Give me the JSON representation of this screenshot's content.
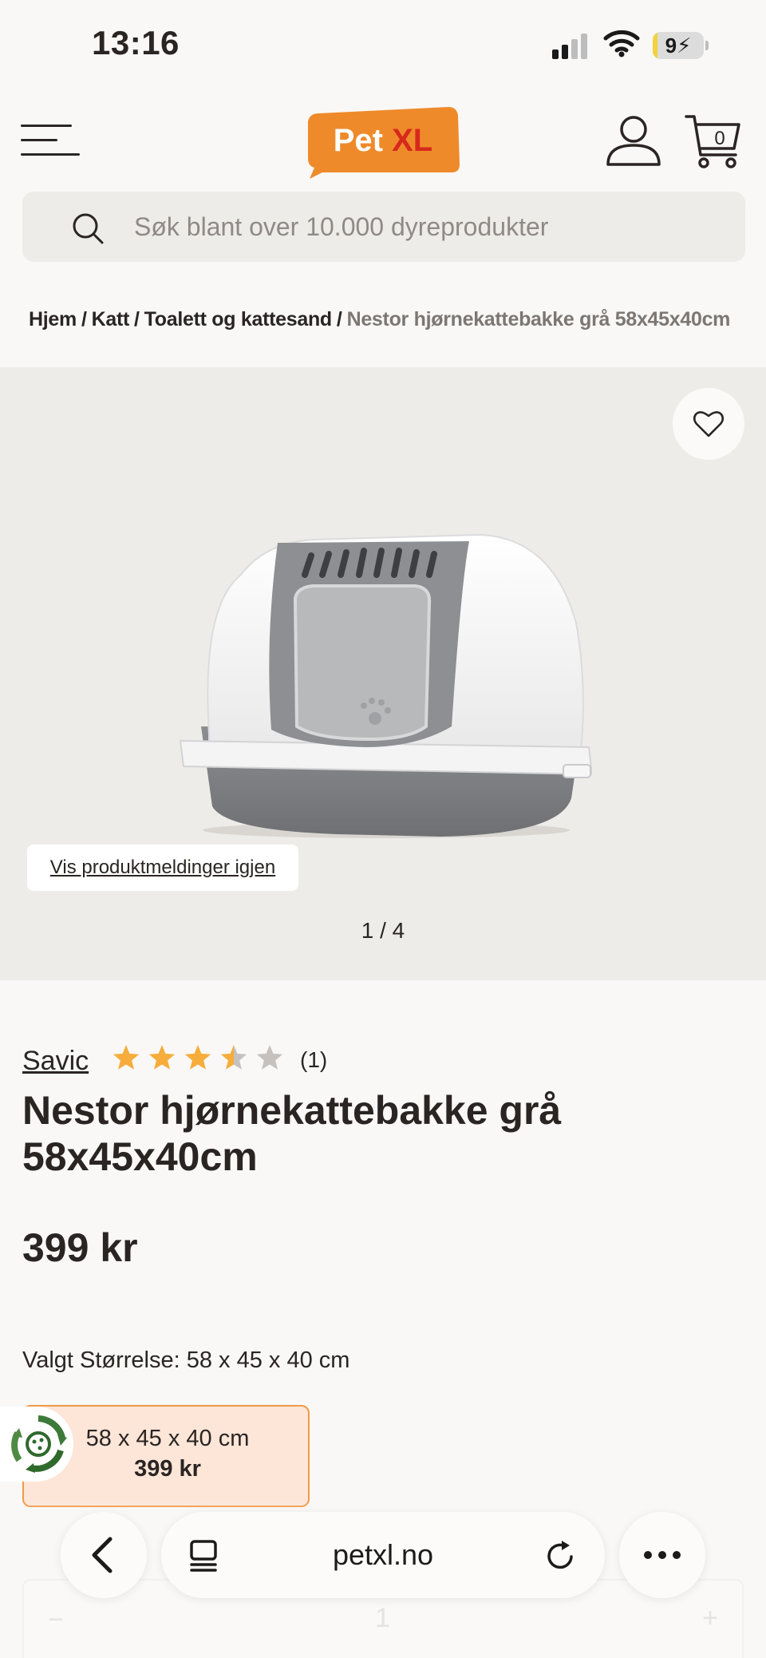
{
  "status_bar": {
    "time": "13:16",
    "battery_level": "9",
    "battery_percent": 9
  },
  "header": {
    "logo": {
      "pet": "Pet",
      "xl": "XL"
    },
    "cart_count": "0"
  },
  "search": {
    "placeholder": "Søk blant over 10.000 dyreprodukter"
  },
  "breadcrumb": {
    "items": [
      "Hjem",
      "Katt",
      "Toalett og kattesand"
    ],
    "separator": "/",
    "current": "Nestor hjørnekattebakke grå 58x45x40cm"
  },
  "gallery": {
    "notice_button": "Vis produktmeldinger igjen",
    "counter": "1 / 4"
  },
  "product": {
    "brand": "Savic",
    "rating": 3.5,
    "rating_max": 5,
    "rating_count": "(1)",
    "title": "Nestor hjørnekattebakke grå 58x45x40cm",
    "price": "399 kr",
    "size_label": "Valgt Størrelse:",
    "size_value": "58 x 45 x 40 cm",
    "size_options": [
      {
        "name": "58 x 45 x 40 cm",
        "price": "399 kr"
      }
    ]
  },
  "quantity": {
    "minus": "−",
    "value": "1",
    "plus": "+"
  },
  "browser": {
    "url": "petxl.no"
  },
  "colors": {
    "accent_orange": "#ef8a2a",
    "brand_red": "#d7281d",
    "star": "#f6ad3b",
    "star_empty": "#c4c1be"
  }
}
